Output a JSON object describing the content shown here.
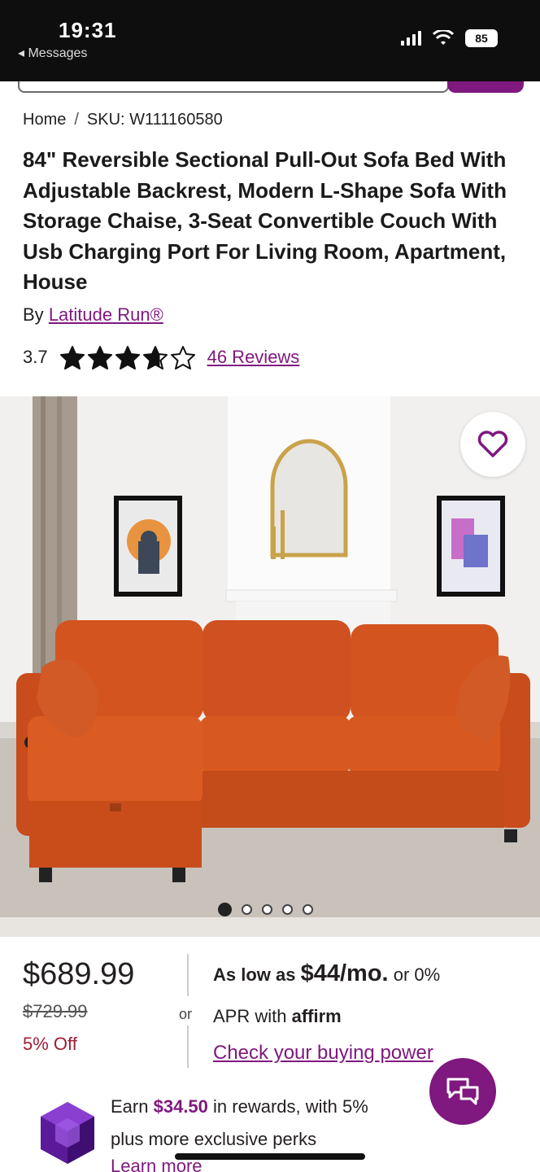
{
  "status_bar": {
    "time": "19:31",
    "back_label": "◂ Messages",
    "battery": "85"
  },
  "breadcrumb": {
    "home": "Home",
    "separator": "/",
    "sku": "SKU: W111160580"
  },
  "product": {
    "title": "84\" Reversible Sectional Pull-Out Sofa Bed With Adjustable Backrest, Modern L-Shape Sofa With Storage Chaise, 3-Seat Convertible Couch With Usb Charging Port For Living Room, Apartment, House",
    "by_label": "By",
    "brand": "Latitude Run®",
    "rating_value": "3.7",
    "rating_stars": 3.7,
    "reviews_label": "46 Reviews"
  },
  "gallery": {
    "image_count": 5,
    "active_index": 0
  },
  "pricing": {
    "price": "$689.99",
    "was_price": "$729.99",
    "discount": "5% Off",
    "or_label": "or",
    "low_prefix": "As low as",
    "monthly": "$44/mo.",
    "low_suffix": "or 0%",
    "apr_prefix": "APR with",
    "affirm": "affirm",
    "buying_power": "Check your buying power"
  },
  "rewards": {
    "earn_prefix": "Earn",
    "amount": "$34.50",
    "earn_suffix": "in rewards, with 5%",
    "line2": "plus more exclusive perks",
    "learn_more": "Learn more"
  },
  "colors": {
    "brand": "#7f187f",
    "discount": "#9f1d35",
    "sofa": "#d4541f"
  },
  "icons": [
    "heart-icon",
    "chat-icon",
    "star-icon",
    "rewards-gem-icon",
    "wifi-icon",
    "signal-icon"
  ]
}
